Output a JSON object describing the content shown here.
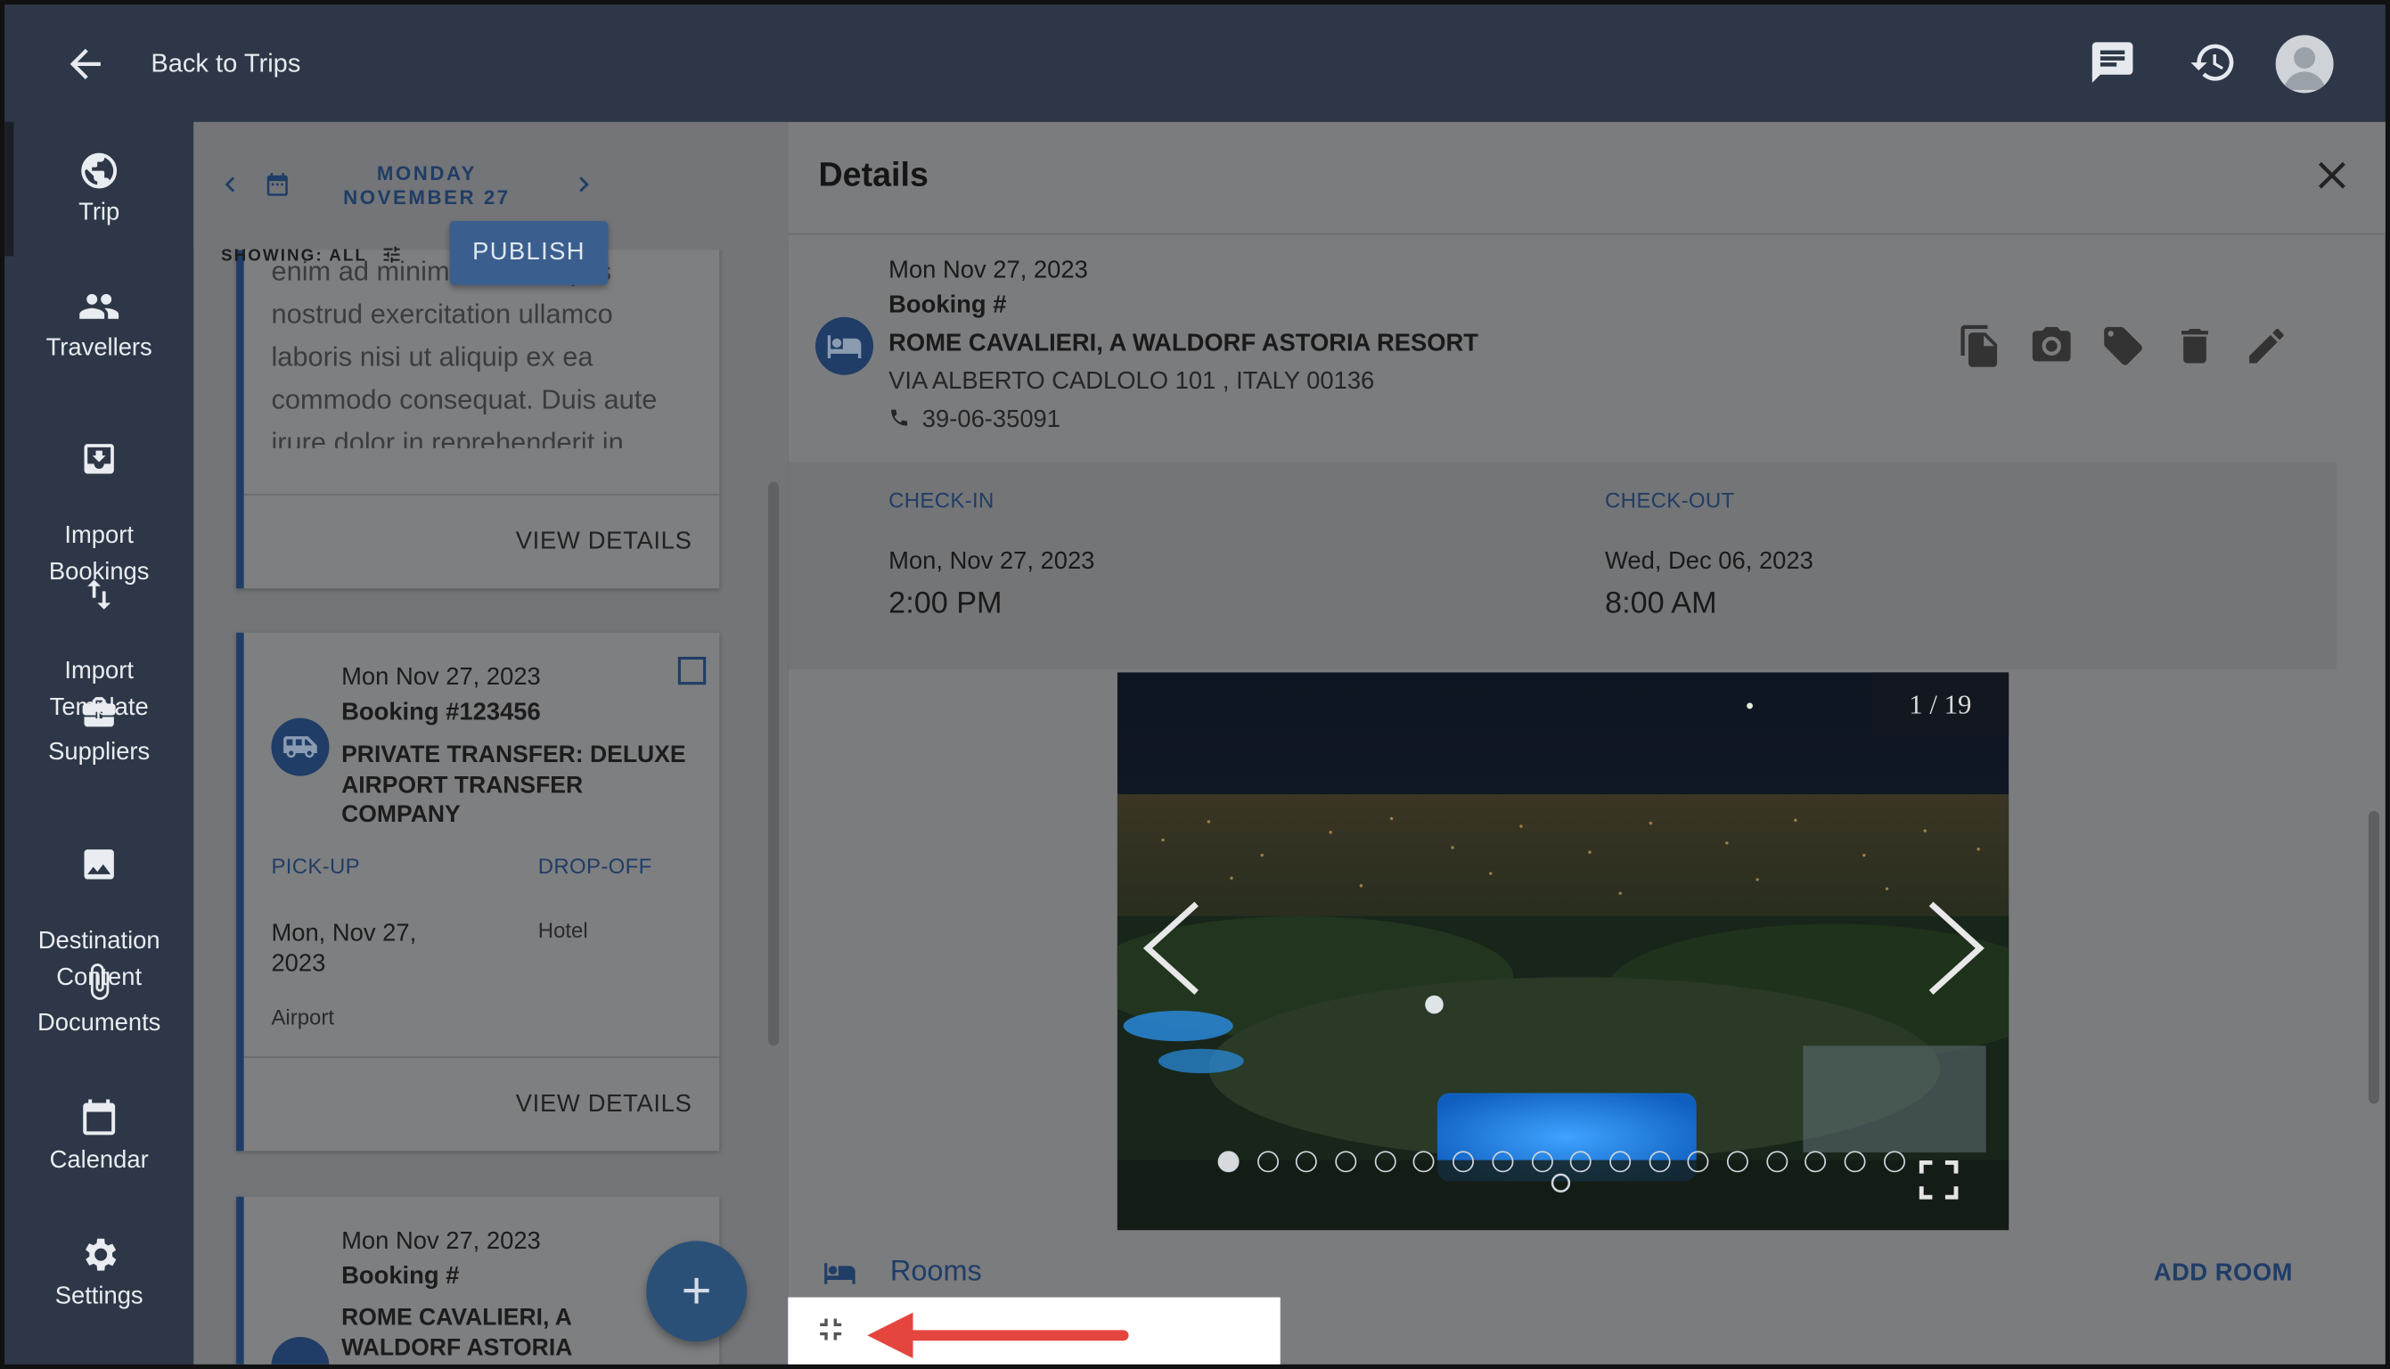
{
  "topbar": {
    "back_label": "Back to Trips",
    "icons": [
      "chat-icon",
      "history-icon",
      "avatar"
    ]
  },
  "nav": {
    "items": [
      {
        "label": "Trip",
        "icon": "globe-icon"
      },
      {
        "label": "Travellers",
        "icon": "people-icon"
      },
      {
        "label": "Import\nBookings",
        "icon": "import-icon"
      },
      {
        "label": "Import\nTemplate",
        "icon": "swap-vertical-icon"
      },
      {
        "label": "Suppliers",
        "icon": "briefcase-icon"
      },
      {
        "label": "Destination\nContent",
        "icon": "image-icon"
      },
      {
        "label": "Documents",
        "icon": "paperclip-icon"
      },
      {
        "label": "Calendar",
        "icon": "calendar-icon"
      },
      {
        "label": "Settings",
        "icon": "gear-icon"
      }
    ]
  },
  "itinerary": {
    "day": "MONDAY",
    "date": "NOVEMBER 27",
    "showing": "SHOWING: ALL",
    "publish": "PUBLISH",
    "card1": {
      "body": "enim ad minim veniam, quis nostrud exercitation ullamco laboris nisi ut aliquip ex ea commodo consequat. Duis aute irure dolor in reprehenderit in",
      "view": "VIEW DETAILS"
    },
    "card2": {
      "date": "Mon Nov 27, 2023",
      "booking": "Booking #123456",
      "title": "PRIVATE TRANSFER: DELUXE AIRPORT TRANSFER COMPANY",
      "pickup_label": "PICK-UP",
      "dropoff_label": "DROP-OFF",
      "pickup_date": "Mon, Nov 27, 2023",
      "pickup_place": "Airport",
      "dropoff_place": "Hotel",
      "view": "VIEW DETAILS"
    },
    "card3": {
      "date": "Mon Nov 27, 2023",
      "booking": "Booking #",
      "title": "ROME CAVALIERI, A WALDORF ASTORIA RESORT"
    },
    "fab": "+"
  },
  "details": {
    "title": "Details",
    "date": "Mon Nov 27, 2023",
    "booking": "Booking #",
    "hotel": "ROME CAVALIERI, A WALDORF ASTORIA RESORT",
    "address": "VIA ALBERTO CADLOLO 101 , ITALY 00136",
    "phone": "39-06-35091",
    "checkin_label": "CHECK-IN",
    "checkout_label": "CHECK-OUT",
    "checkin_date": "Mon, Nov 27, 2023",
    "checkin_time": "2:00 PM",
    "checkout_date": "Wed, Dec 06, 2023",
    "checkout_time": "8:00 AM",
    "gallery": {
      "counter": "1 / 19",
      "total": 19,
      "current": 1
    },
    "rooms_label": "Rooms",
    "add_room": "ADD ROOM",
    "actions": [
      "copy-icon",
      "camera-icon",
      "tag-icon",
      "delete-icon",
      "edit-icon"
    ]
  }
}
